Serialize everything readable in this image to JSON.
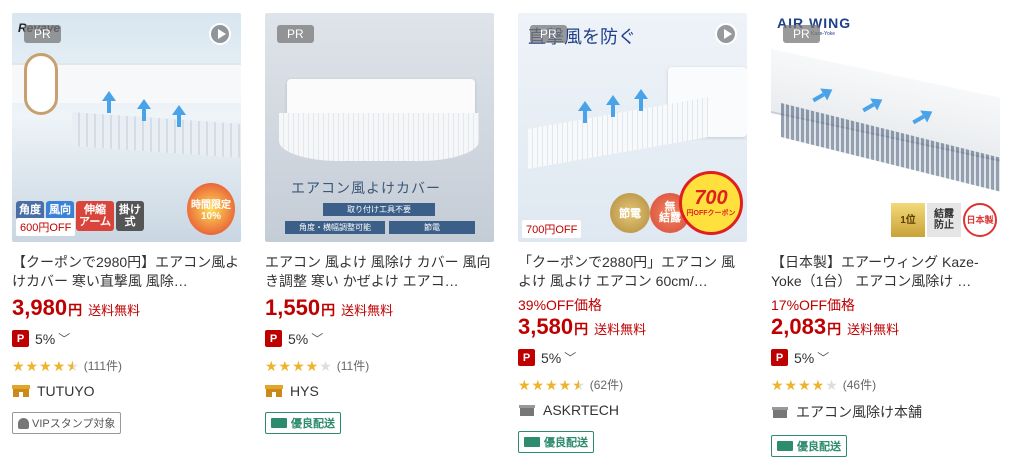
{
  "products": [
    {
      "pr": "PR",
      "img": {
        "brand": "Revave",
        "tags": [
          "角度",
          "風向",
          "伸縮\nアーム",
          "掛け\n式"
        ],
        "coupon": "600円OFF",
        "limited": "時間限定\n10%"
      },
      "title": "【クーポンで2980円】エアコン風よけカバー 寒い直撃風 風除…",
      "discount": "",
      "price": "3,980",
      "yen": "円",
      "shipping": "送料無料",
      "points": "5%",
      "rating": 4.5,
      "reviews": "(111件)",
      "shop": "TUTUYO",
      "badge": "VIPスタンプ対象",
      "badge_type": "vip"
    },
    {
      "pr": "PR",
      "img": {
        "caption": "エアコン風よけカバー",
        "strip1": "取り付け工具不要",
        "strip2": "角度・横幅調整可能",
        "strip3": "節電"
      },
      "title": "エアコン 風よけ 風除け カバー 風向き調整 寒い かぜよけ エアコ…",
      "discount": "",
      "price": "1,550",
      "yen": "円",
      "shipping": "送料無料",
      "points": "5%",
      "rating": 4.0,
      "reviews": "(11件)",
      "shop": "HYS",
      "badge": "優良配送",
      "badge_type": "ship"
    },
    {
      "pr": "PR",
      "img": {
        "heading": "直撃風を防ぐ",
        "coupon": "700円OFF",
        "seal1": "節電",
        "seal2": "無\n結露",
        "big": "700",
        "big_sub": "円OFFクーポン"
      },
      "title": "「クーポンで2880円」エアコン 風よけ 風よけ エアコン 60cm/…",
      "discount": "39%OFF価格",
      "price": "3,580",
      "yen": "円",
      "shipping": "送料無料",
      "points": "5%",
      "rating": 4.5,
      "reviews": "(62件)",
      "shop": "ASKRTECH",
      "badge": "優良配送",
      "badge_type": "ship"
    },
    {
      "pr": "PR",
      "img": {
        "brand": "AIR WING",
        "brand_sub": "Kaze-Yoke",
        "seal1": "1位",
        "seal2": "結露\n防止",
        "seal3": "日本製"
      },
      "title": "【日本製】エアーウィング Kaze-Yoke（1台） エアコン風除け …",
      "discount": "17%OFF価格",
      "price": "2,083",
      "yen": "円",
      "shipping": "送料無料",
      "points": "5%",
      "rating": 4.0,
      "reviews": "(46件)",
      "shop": "エアコン風除け本舗",
      "badge": "優良配送",
      "badge_type": "ship"
    }
  ],
  "colors": {
    "price": "#bf0000",
    "star": "#f0b429",
    "ship_badge": "#2d8b6e"
  }
}
